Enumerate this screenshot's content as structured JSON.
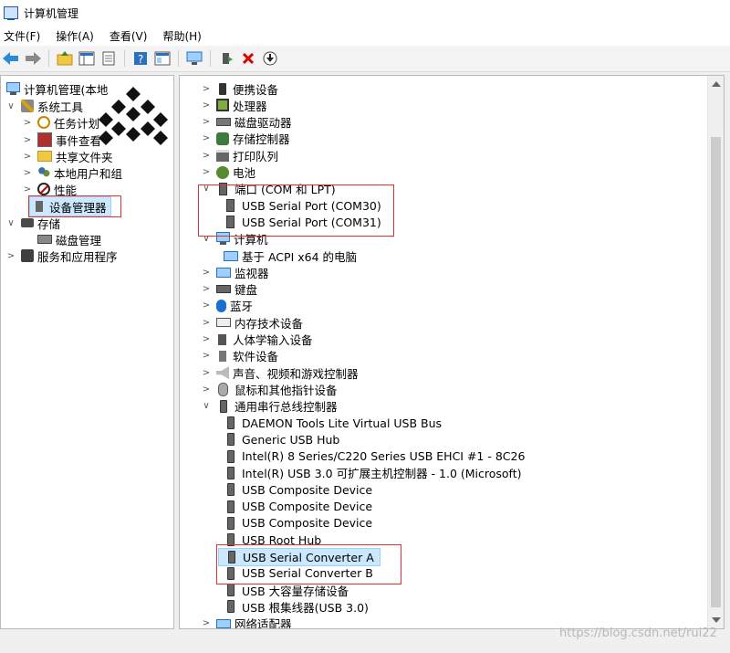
{
  "window": {
    "title": "计算机管理"
  },
  "menu": [
    "文件(F)",
    "操作(A)",
    "查看(V)",
    "帮助(H)"
  ],
  "toolbar_icons": [
    "back-arrow-icon",
    "forward-arrow-icon",
    "up-folder-icon",
    "show-hide-tree-icon",
    "properties-icon",
    "help-icon",
    "console-tree-icon",
    "monitor-icon",
    "update-driver-icon",
    "uninstall-icon",
    "download-icon"
  ],
  "left_tree": [
    {
      "label": "计算机管理(本地",
      "chevron": "",
      "icon": "computer"
    },
    {
      "label": "系统工具",
      "chevron": "∨",
      "icon": "tools"
    },
    {
      "label": "任务计划",
      "chevron": ">",
      "icon": "clock"
    },
    {
      "label": "事件查看",
      "chevron": ">",
      "icon": "viewer"
    },
    {
      "label": "共享文件夹",
      "chevron": ">",
      "icon": "folder"
    },
    {
      "label": "本地用户和组",
      "chevron": ">",
      "icon": "users"
    },
    {
      "label": "性能",
      "chevron": ">",
      "icon": "perf"
    },
    {
      "label": "设备管理器",
      "chevron": "",
      "icon": "devmgr",
      "selected": true
    },
    {
      "label": "存储",
      "chevron": "∨",
      "icon": "storage"
    },
    {
      "label": "磁盘管理",
      "chevron": "",
      "icon": "disk"
    },
    {
      "label": "服务和应用程序",
      "chevron": ">",
      "icon": "services"
    }
  ],
  "device_tree": [
    {
      "label": "便携设备",
      "chevron": ">",
      "icon": "phone",
      "level": 0
    },
    {
      "label": "处理器",
      "chevron": ">",
      "icon": "cpu",
      "level": 0
    },
    {
      "label": "磁盘驱动器",
      "chevron": ">",
      "icon": "drive",
      "level": 0
    },
    {
      "label": "存储控制器",
      "chevron": ">",
      "icon": "storagectl",
      "level": 0
    },
    {
      "label": "打印队列",
      "chevron": ">",
      "icon": "printer",
      "level": 0
    },
    {
      "label": "电池",
      "chevron": ">",
      "icon": "battery",
      "level": 0
    },
    {
      "label": "端口 (COM 和 LPT)",
      "chevron": "∨",
      "icon": "port",
      "level": 0
    },
    {
      "label": "USB Serial Port (COM30)",
      "chevron": "",
      "icon": "port",
      "level": 1
    },
    {
      "label": "USB Serial Port (COM31)",
      "chevron": "",
      "icon": "port",
      "level": 1
    },
    {
      "label": "计算机",
      "chevron": "∨",
      "icon": "computer",
      "level": 0
    },
    {
      "label": "基于 ACPI x64 的电脑",
      "chevron": "",
      "icon": "monitor",
      "level": 1
    },
    {
      "label": "监视器",
      "chevron": ">",
      "icon": "monitor",
      "level": 0
    },
    {
      "label": "键盘",
      "chevron": ">",
      "icon": "keyboard",
      "level": 0
    },
    {
      "label": "蓝牙",
      "chevron": ">",
      "icon": "bluetooth",
      "level": 0
    },
    {
      "label": "内存技术设备",
      "chevron": ">",
      "icon": "memory",
      "level": 0
    },
    {
      "label": "人体学输入设备",
      "chevron": ">",
      "icon": "hid",
      "level": 0
    },
    {
      "label": "软件设备",
      "chevron": ">",
      "icon": "software",
      "level": 0
    },
    {
      "label": "声音、视频和游戏控制器",
      "chevron": ">",
      "icon": "sound",
      "level": 0
    },
    {
      "label": "鼠标和其他指针设备",
      "chevron": ">",
      "icon": "mouse",
      "level": 0
    },
    {
      "label": "通用串行总线控制器",
      "chevron": "∨",
      "icon": "usb",
      "level": 0
    },
    {
      "label": "DAEMON Tools Lite Virtual USB Bus",
      "chevron": "",
      "icon": "usb",
      "level": 1
    },
    {
      "label": "Generic USB Hub",
      "chevron": "",
      "icon": "usb",
      "level": 1
    },
    {
      "label": "Intel(R) 8 Series/C220 Series USB EHCI #1 - 8C26",
      "chevron": "",
      "icon": "usb",
      "level": 1
    },
    {
      "label": "Intel(R) USB 3.0 可扩展主机控制器 - 1.0 (Microsoft)",
      "chevron": "",
      "icon": "usb",
      "level": 1
    },
    {
      "label": "USB Composite Device",
      "chevron": "",
      "icon": "usb",
      "level": 1
    },
    {
      "label": "USB Composite Device",
      "chevron": "",
      "icon": "usb",
      "level": 1
    },
    {
      "label": "USB Composite Device",
      "chevron": "",
      "icon": "usb",
      "level": 1
    },
    {
      "label": "USB Root Hub",
      "chevron": "",
      "icon": "usb",
      "level": 1
    },
    {
      "label": "USB Serial Converter A",
      "chevron": "",
      "icon": "usb",
      "level": 1,
      "selected": true
    },
    {
      "label": "USB Serial Converter B",
      "chevron": "",
      "icon": "usb",
      "level": 1
    },
    {
      "label": "USB 大容量存储设备",
      "chevron": "",
      "icon": "usb",
      "level": 1
    },
    {
      "label": "USB 根集线器(USB 3.0)",
      "chevron": "",
      "icon": "usb",
      "level": 1
    },
    {
      "label": "网络适配器",
      "chevron": ">",
      "icon": "network",
      "level": 0
    }
  ],
  "watermark": "https://blog.csdn.net/rui22",
  "colors": {
    "highlight_box": "#e0322c",
    "selection": "#cce8ff"
  }
}
